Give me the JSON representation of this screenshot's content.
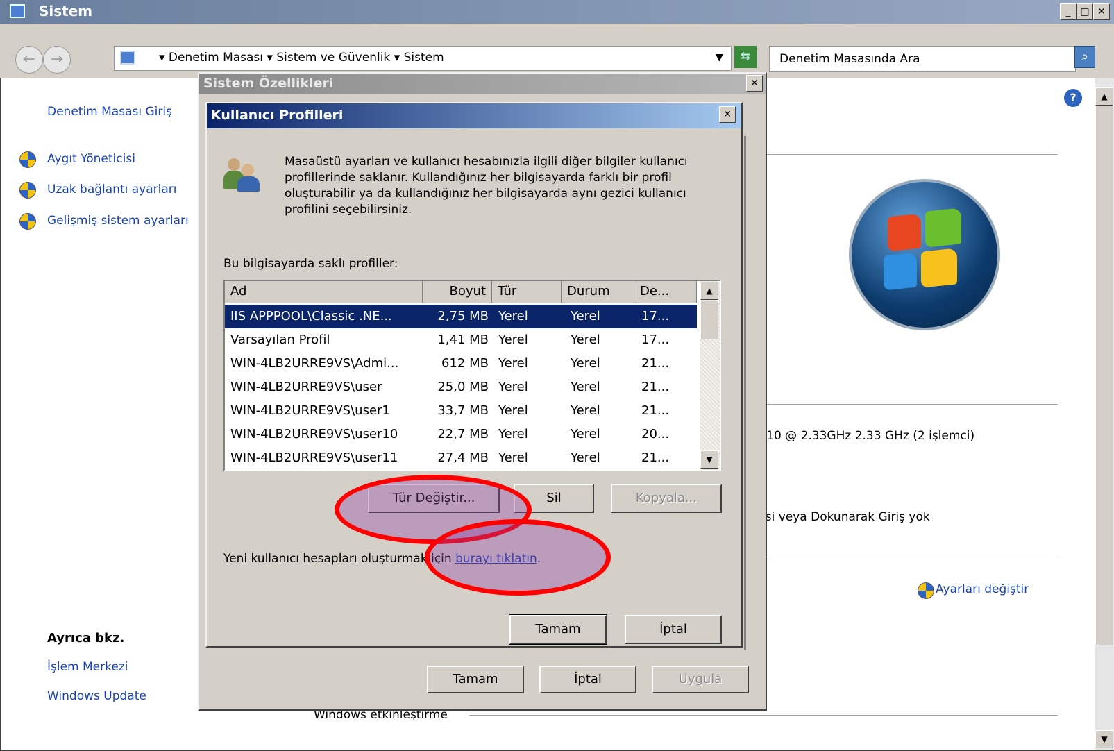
{
  "window": {
    "title": "Sistem"
  },
  "address": {
    "crumbs": "▾ Denetim Masası ▾ Sistem ve Güvenlik ▾ Sistem",
    "search_placeholder": "Denetim Masasında Ara"
  },
  "left": {
    "home": "Denetim Masası Giriş",
    "tasks": [
      "Aygıt Yöneticisi",
      "Uzak bağlantı ayarları",
      "Gelişmiş sistem ayarları"
    ],
    "see_also_title": "Ayrıca bkz.",
    "see_also": [
      "İşlem Merkezi",
      "Windows Update"
    ]
  },
  "main": {
    "processor": "-10  @ 2.33GHz   2.33 GHz  (2 işlemci)",
    "pen": "isi veya Dokunarak Giriş yok",
    "change_settings": "Ayarları değiştir",
    "activation": "Windows etkinleştirme"
  },
  "sysprops": {
    "title": "Sistem Özellikleri",
    "ok": "Tamam",
    "cancel": "İptal",
    "apply": "Uygula"
  },
  "profiles": {
    "title": "Kullanıcı Profilleri",
    "description": "Masaüstü ayarları ve kullanıcı hesabınızla ilgili diğer bilgiler kullanıcı profillerinde saklanır.  Kullandığınız her bilgisayarda farklı bir profil oluşturabilir ya da kullandığınız her bilgisayarda aynı gezici kullanıcı profilini seçebilirsiniz.",
    "list_label": "Bu bilgisayarda saklı profiller:",
    "columns": [
      "Ad",
      "Boyut",
      "Tür",
      "Durum",
      "De..."
    ],
    "rows": [
      [
        "IIS APPPOOL\\Classic .NE...",
        "2,75 MB",
        "Yerel",
        "Yerel",
        "17..."
      ],
      [
        "Varsayılan Profil",
        "1,41 MB",
        "Yerel",
        "Yerel",
        "17..."
      ],
      [
        "WIN-4LB2URRE9VS\\Admi...",
        "612 MB",
        "Yerel",
        "Yerel",
        "21..."
      ],
      [
        "WIN-4LB2URRE9VS\\user",
        "25,0 MB",
        "Yerel",
        "Yerel",
        "21..."
      ],
      [
        "WIN-4LB2URRE9VS\\user1",
        "33,7 MB",
        "Yerel",
        "Yerel",
        "21..."
      ],
      [
        "WIN-4LB2URRE9VS\\user10",
        "22,7 MB",
        "Yerel",
        "Yerel",
        "20..."
      ],
      [
        "WIN-4LB2URRE9VS\\user11",
        "27,4 MB",
        "Yerel",
        "Yerel",
        "21..."
      ]
    ],
    "change_type": "Tür Değiştir...",
    "delete": "Sil",
    "copy": "Kopyala...",
    "new_account_prefix": "Yeni kullanıcı hesapları oluşturmak için ",
    "new_account_link": "burayı tıklatın",
    "new_account_suffix": ".",
    "ok": "Tamam",
    "cancel": "İptal"
  }
}
